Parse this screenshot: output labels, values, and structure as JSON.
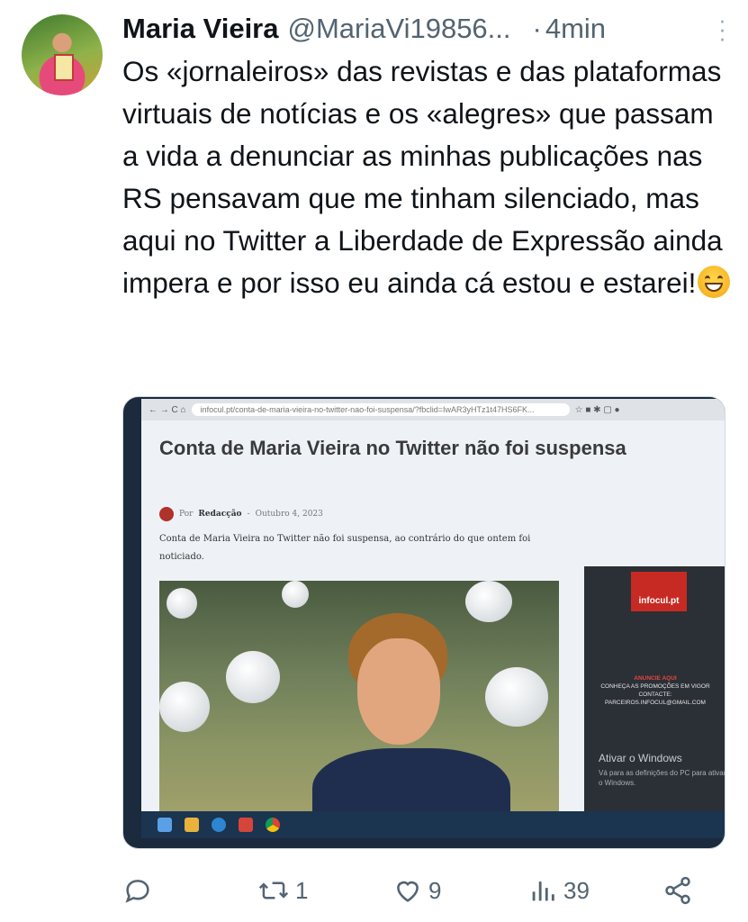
{
  "tweet": {
    "author_name": "Maria Vieira",
    "author_handle": "@MariaVi19856...",
    "separator": "·",
    "time": "4min",
    "text": "Os «jornaleiros» das revistas e das plataformas virtuais de notícias e os «alegres» que passam a vida a denunciar as minhas publicações nas RS pensavam que me tinham silenciado, mas aqui no Twitter a Liberdade de Expressão ainda impera e por isso eu ainda cá estou e estarei!",
    "emoji": "grinning-face-with-sweat"
  },
  "media": {
    "url": "infocul.pt/conta-de-maria-vieira-no-twitter-nao-foi-suspensa/?fbclid=IwAR3yHTz1t47HS6FK...",
    "article_title": "Conta de Maria Vieira no Twitter não foi suspensa",
    "byline_prefix": "Por",
    "byline_author": "Redacção",
    "byline_sep": "-",
    "byline_date": "Outubro 4, 2023",
    "excerpt": "Conta de Maria Vieira no Twitter não foi suspensa, ao contrário do que ontem foi noticiado.",
    "ad_brand": "infocul.pt",
    "ad_cta": "ANUNCIE AQUI",
    "ad_line1": "CONHEÇA AS PROMOÇÕES EM VIGOR",
    "ad_line2": "CONTACTE: PARCEIROS.INFOCUL@GMAIL.COM",
    "activate_title": "Ativar o Windows",
    "activate_sub": "Vá para as definições do PC para ativar o Windows."
  },
  "actions": {
    "reply_count": "",
    "retweet_count": "1",
    "like_count": "9",
    "views_count": "39"
  },
  "colors": {
    "text": "#0f1419",
    "muted": "#536471",
    "site_red": "#c72a22"
  }
}
